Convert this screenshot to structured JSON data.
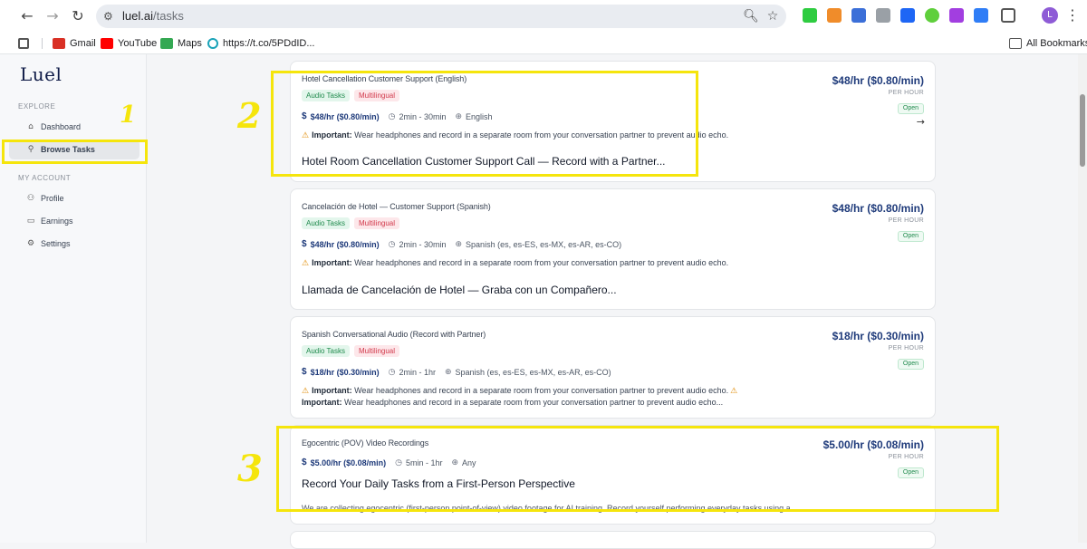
{
  "browser": {
    "url_host": "luel.ai",
    "url_path": "/tasks",
    "profile_initial": "L",
    "bookmarks": [
      {
        "label": "Gmail",
        "color": "#d93025"
      },
      {
        "label": "YouTube",
        "color": "#ff0000"
      },
      {
        "label": "Maps",
        "color": "#34a853"
      },
      {
        "label": "https://t.co/5PDdID...",
        "color": "#1aa3b8"
      }
    ],
    "all_bookmarks": "All Bookmarks"
  },
  "sidebar": {
    "logo": "Luel",
    "explore_label": "EXPLORE",
    "my_account_label": "MY ACCOUNT",
    "items": [
      {
        "label": "Dashboard",
        "icon": "home-icon",
        "active": false
      },
      {
        "label": "Browse Tasks",
        "icon": "search-icon",
        "active": true
      },
      {
        "label": "Profile",
        "icon": "user-icon",
        "active": false
      },
      {
        "label": "Earnings",
        "icon": "card-icon",
        "active": false
      },
      {
        "label": "Settings",
        "icon": "gear-icon",
        "active": false
      }
    ]
  },
  "tasks": [
    {
      "subtitle": "Hotel Cancellation Customer Support (English)",
      "tags": [
        "Audio Tasks",
        "Multilingual"
      ],
      "rate": "$48/hr ($0.80/min)",
      "duration": "2min - 30min",
      "language": "English",
      "important_label": "Important:",
      "important_text": "Wear headphones and record in a separate room from your conversation partner to prevent audio echo.",
      "title": "Hotel Room Cancellation Customer Support Call — Record with a Partner...",
      "price": "$48/hr ($0.80/min)",
      "per_hour": "PER HOUR",
      "status": "Open"
    },
    {
      "subtitle": "Cancelación de Hotel — Customer Support (Spanish)",
      "tags": [
        "Audio Tasks",
        "Multilingual"
      ],
      "rate": "$48/hr ($0.80/min)",
      "duration": "2min - 30min",
      "language": "Spanish (es, es-ES, es-MX, es-AR, es-CO)",
      "important_label": "Important:",
      "important_text": "Wear headphones and record in a separate room from your conversation partner to prevent audio echo.",
      "title": "Llamada de Cancelación de Hotel — Graba con un Compañero...",
      "price": "$48/hr ($0.80/min)",
      "per_hour": "PER HOUR",
      "status": "Open"
    },
    {
      "subtitle": "Spanish Conversational Audio (Record with Partner)",
      "tags": [
        "Audio Tasks",
        "Multilingual"
      ],
      "rate": "$18/hr ($0.30/min)",
      "duration": "2min - 1hr",
      "language": "Spanish (es, es-ES, es-MX, es-AR, es-CO)",
      "important_label": "Important:",
      "important_text": "Wear headphones and record in a separate room from your conversation partner to prevent audio echo.",
      "important2_label": "Important:",
      "important2_text": "Wear headphones and record in a separate room from your conversation partner to prevent audio echo...",
      "price": "$18/hr ($0.30/min)",
      "per_hour": "PER HOUR",
      "status": "Open"
    },
    {
      "subtitle": "Egocentric (POV) Video Recordings",
      "rate": "$5.00/hr ($0.08/min)",
      "duration": "5min - 1hr",
      "language": "Any",
      "title": "Record Your Daily Tasks from a First-Person Perspective",
      "description": "We are collecting egocentric (first-person point-of-view) video footage for AI training. Record yourself performing everyday tasks using a...",
      "price": "$5.00/hr ($0.08/min)",
      "per_hour": "PER HOUR",
      "status": "Open"
    }
  ],
  "annotations": {
    "one": "1",
    "two": "2",
    "three": "3",
    "color": "#f5e50c"
  }
}
